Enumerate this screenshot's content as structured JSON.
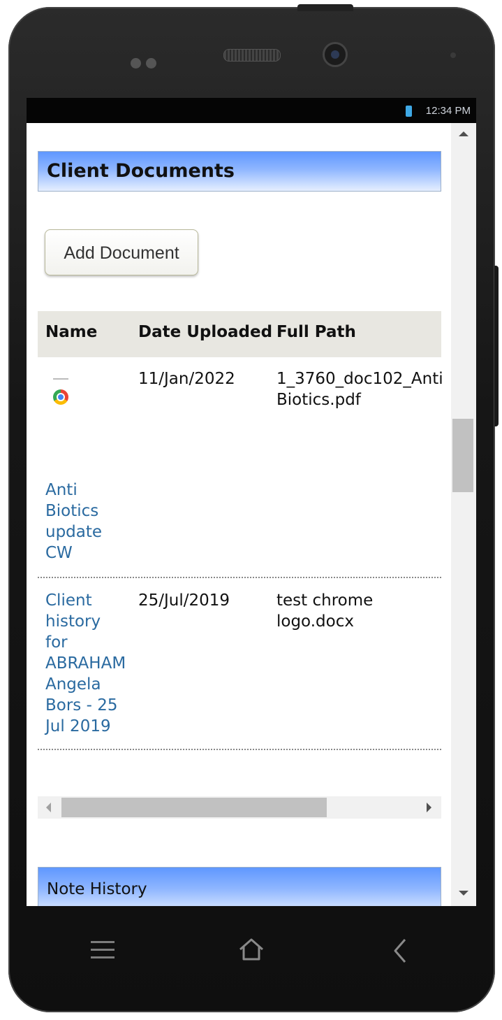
{
  "status_bar": {
    "time": "12:34 PM"
  },
  "section": {
    "title": "Client Documents"
  },
  "actions": {
    "add_document": "Add Document"
  },
  "table": {
    "headers": {
      "name": "Name",
      "date": "Date Uploaded",
      "path": "Full Path"
    },
    "rows": [
      {
        "name_lines": [
          "Anti",
          "Biotics",
          "update",
          "CW"
        ],
        "date": "11/Jan/2022",
        "path_lines": [
          "1_3760_doc102_Anti",
          "Biotics.pdf"
        ],
        "icon": "chrome-icon"
      },
      {
        "name_lines": [
          "Client",
          "history",
          "for",
          "ABRAHAM",
          "Angela",
          "Bors - 25",
          "Jul 2019"
        ],
        "date": "25/Jul/2019",
        "path_lines": [
          "test chrome",
          "logo.docx"
        ]
      }
    ]
  },
  "note_history": {
    "title": "Note History"
  },
  "colors": {
    "header_gradient_start": "#5f97ff",
    "link": "#2a6aa0",
    "table_header_bg": "#e8e7e1"
  }
}
